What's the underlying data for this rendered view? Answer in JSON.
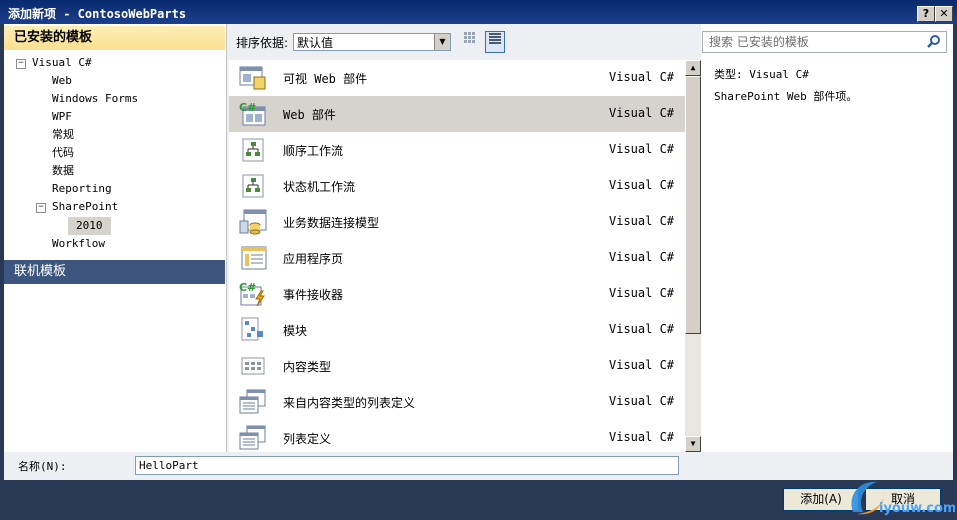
{
  "window": {
    "title": "添加新项 - ContosoWebParts",
    "help_label": "?",
    "close_label": "✕"
  },
  "left_panel": {
    "installed_header": "已安装的模板",
    "tree": [
      {
        "label": "Visual C#",
        "expander": "−"
      },
      {
        "label": "Web"
      },
      {
        "label": "Windows Forms"
      },
      {
        "label": "WPF"
      },
      {
        "label": "常规"
      },
      {
        "label": "代码"
      },
      {
        "label": "数据"
      },
      {
        "label": "Reporting"
      },
      {
        "label": "SharePoint",
        "expander": "−"
      },
      {
        "label": "2010"
      },
      {
        "label": "Workflow"
      }
    ],
    "online_header": "联机模板"
  },
  "toolbar": {
    "sort_label": "排序依据:",
    "sort_value": "默认值"
  },
  "templates": [
    {
      "name": "可视 Web 部件",
      "lang": "Visual C#"
    },
    {
      "name": "Web 部件",
      "lang": "Visual C#"
    },
    {
      "name": "顺序工作流",
      "lang": "Visual C#"
    },
    {
      "name": "状态机工作流",
      "lang": "Visual C#"
    },
    {
      "name": "业务数据连接模型",
      "lang": "Visual C#"
    },
    {
      "name": "应用程序页",
      "lang": "Visual C#"
    },
    {
      "name": "事件接收器",
      "lang": "Visual C#"
    },
    {
      "name": "模块",
      "lang": "Visual C#"
    },
    {
      "name": "内容类型",
      "lang": "Visual C#"
    },
    {
      "name": "来自内容类型的列表定义",
      "lang": "Visual C#"
    },
    {
      "name": "列表定义",
      "lang": "Visual C#"
    }
  ],
  "details": {
    "search_placeholder": "搜索 已安装的模板",
    "type_line": "类型: Visual C#",
    "description": "SharePoint Web 部件项。"
  },
  "bottom": {
    "name_label": "名称(N):",
    "name_value": "HelloPart",
    "add_label": "添加(A)",
    "cancel_label": "取消"
  },
  "watermark": {
    "text": "iyouw.com"
  },
  "colors": {
    "selected_row": "#d6d3ce",
    "installed_header": "#fbdf91",
    "online_header": "#3d5680",
    "window_bg": "#293955"
  }
}
